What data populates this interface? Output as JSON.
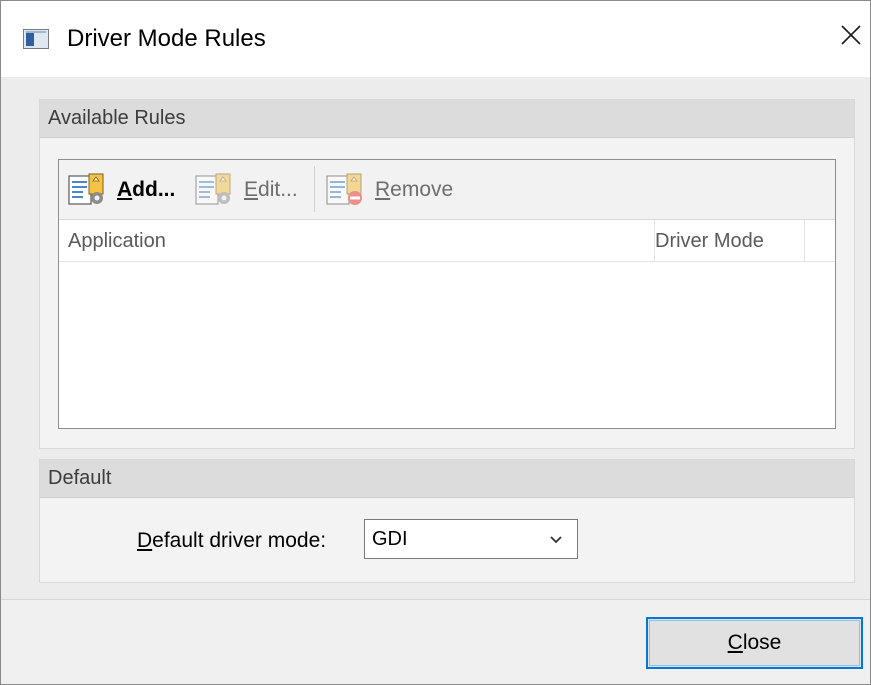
{
  "window": {
    "title": "Driver Mode Rules"
  },
  "rules_group": {
    "title": "Available Rules",
    "toolbar": {
      "add_label_key": "A",
      "add_label_rest": "dd...",
      "edit_label_key": "E",
      "edit_label_rest": "dit...",
      "remove_label_key": "R",
      "remove_label_rest": "emove"
    },
    "columns": [
      "Application",
      "Driver Mode"
    ],
    "rows": []
  },
  "default_group": {
    "title": "Default",
    "field_label_key": "D",
    "field_label_rest": "efault driver mode:",
    "selected_value": "GDI"
  },
  "footer": {
    "close_key": "C",
    "close_rest": "lose"
  },
  "colors": {
    "accent": "#0078d7",
    "disabled_text": "#6d6d6d"
  },
  "icons": [
    "window-icon",
    "close-icon",
    "add-rule-icon",
    "edit-rule-icon",
    "remove-rule-icon",
    "chevron-down-icon"
  ]
}
